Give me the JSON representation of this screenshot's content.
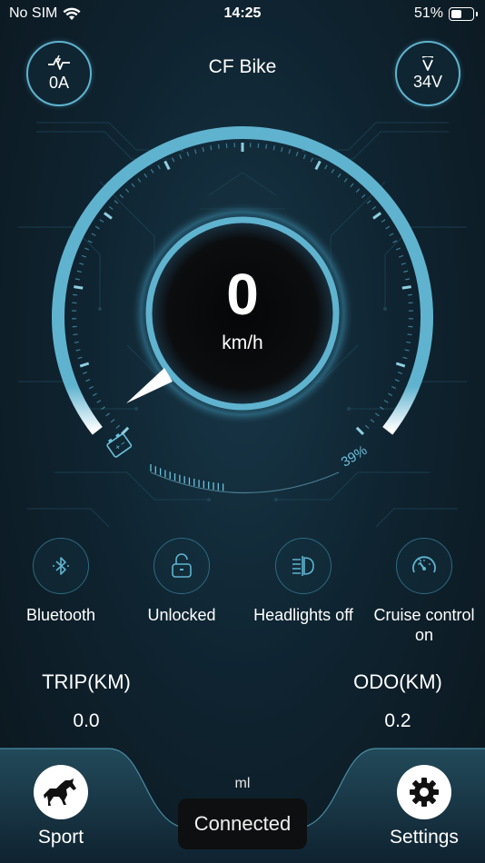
{
  "status_bar": {
    "carrier": "No SIM",
    "time": "14:25",
    "battery_percent": "51%"
  },
  "header": {
    "title": "CF Bike",
    "current_value": "0A",
    "current_icon": "pulse-bolt-icon",
    "voltage_value": "34V",
    "voltage_icon": "voltage-v-icon"
  },
  "speedometer": {
    "speed": "0",
    "unit": "km/h"
  },
  "battery": {
    "percent_label": "39%",
    "level": 0.39,
    "icon": "battery-icon"
  },
  "controls": [
    {
      "label": "Bluetooth",
      "icon": "bluetooth-icon"
    },
    {
      "label": "Unlocked",
      "icon": "unlocked-padlock-icon"
    },
    {
      "label": "Headlights off",
      "icon": "headlight-icon"
    },
    {
      "label": "Cruise control on",
      "icon": "speedometer-icon"
    }
  ],
  "stats": {
    "trip_label": "TRIP(KM)",
    "trip_value": "0.0",
    "odo_label": "ODO(KM)",
    "odo_value": "0.2"
  },
  "bottom": {
    "mode_label": "Sport",
    "mode_icon": "horse-icon",
    "settings_label": "Settings",
    "settings_icon": "gear-icon",
    "unit_text": "ml",
    "toast": "Connected"
  },
  "colors": {
    "accent": "#5fb3cf",
    "background": "#0d1a22"
  }
}
